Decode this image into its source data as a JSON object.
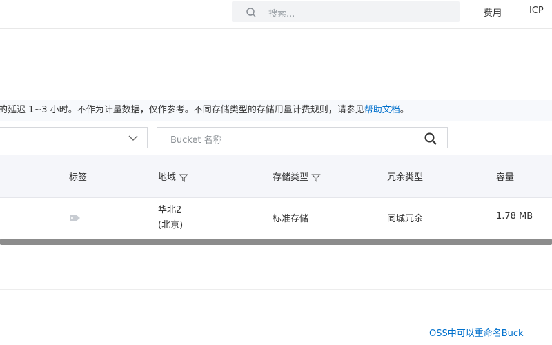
{
  "header": {
    "search_placeholder": "搜索...",
    "links": [
      "费用",
      "ICP"
    ]
  },
  "notice": {
    "text": "的延迟 1~3 小时。不作为计量数据，仅作参考。不同存储类型的存储用量计费规则，请参见",
    "link": "帮助文档",
    "suffix": "。"
  },
  "filter": {
    "region_value": "",
    "bucket_placeholder": "Bucket 名称"
  },
  "table": {
    "columns": [
      "标签",
      "地域",
      "存储类型",
      "冗余类型",
      "容量"
    ],
    "rows": [
      {
        "region_line1": "华北2",
        "region_line2": "(北京)",
        "storage_class": "标准存储",
        "redundancy": "同城冗余",
        "capacity": "1.78 MB"
      }
    ]
  },
  "bottom_link": "OSS中可以重命名Buck"
}
